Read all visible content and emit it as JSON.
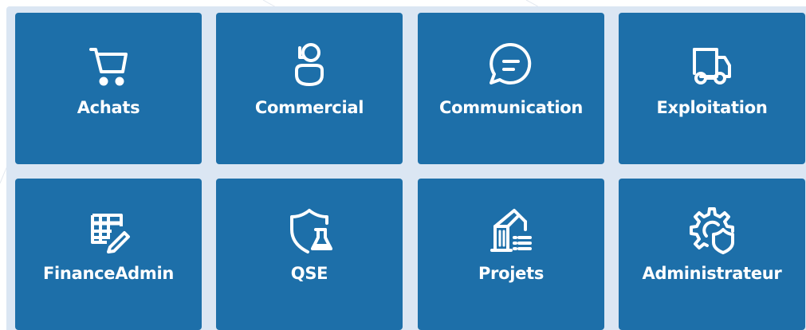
{
  "theme": {
    "tile_color": "#1d6fa9",
    "panel_color": "#dbe6f3",
    "text_color": "#ffffff"
  },
  "tiles": [
    {
      "label": "Achats",
      "icon": "shopping-cart-icon"
    },
    {
      "label": "Commercial",
      "icon": "headset-person-icon"
    },
    {
      "label": "Communication",
      "icon": "chat-bubble-icon"
    },
    {
      "label": "Exploitation",
      "icon": "delivery-truck-icon"
    },
    {
      "label": "FinanceAdmin",
      "icon": "spreadsheet-edit-icon"
    },
    {
      "label": "QSE",
      "icon": "shield-flask-icon"
    },
    {
      "label": "Projets",
      "icon": "crane-list-icon"
    },
    {
      "label": "Administrateur",
      "icon": "gear-shield-icon"
    }
  ]
}
